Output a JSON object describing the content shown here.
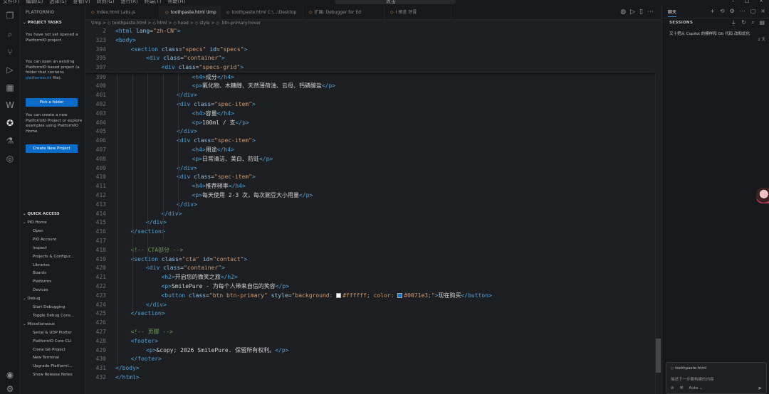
{
  "titlebar": {
    "menu": [
      "文件(F)",
      "编辑(E)",
      "选择(S)",
      "查看(V)",
      "转到(G)",
      "运行(R)",
      "终端(T)",
      "帮助(H)"
    ],
    "search": "点击"
  },
  "sidebar": {
    "title": "PLATFORMIO",
    "project_tasks": "PROJECT TASKS",
    "msg_no_project": "You have not yet opened a PlatformIO project.",
    "msg_open_prefix": "You can open an existing PlatformIO based project (a folder that contains ",
    "msg_open_file": "platformio.ini",
    "msg_open_suffix": " file).",
    "pick_folder": "Pick a folder",
    "msg_create": "You can create a new PlatformIO Project or explore examples using PlatformIO Home.",
    "create_project": "Create New Project",
    "quick_access": "QUICK ACCESS",
    "groups": {
      "pio_home": "PIO Home",
      "debug": "Debug",
      "misc": "Miscellaneous"
    },
    "pio_home_items": [
      "Open",
      "PIO Account",
      "Inspect",
      "Projects & Configur...",
      "Libraries",
      "Boards",
      "Platforms",
      "Devices"
    ],
    "debug_items": [
      "Start Debugging",
      "Toggle Debug Cons..."
    ],
    "misc_items": [
      "Serial & UDP Plotter",
      "PlatformIO Core CLI",
      "Clone Git Project",
      "New Terminal",
      "Upgrade PlatformI...",
      "Show Release Notes"
    ]
  },
  "tabs": [
    {
      "label": "index.html Labs.js",
      "active": false
    },
    {
      "label": "toothpaste.html \\tmp",
      "active": true
    },
    {
      "label": "toothpaste.html C:\\...\\Desktop",
      "active": false
    },
    {
      "label": "扩展: Debugger for Ed",
      "active": false
    },
    {
      "label": "Ⅰ 预览 牙膏",
      "active": false
    }
  ],
  "breadcrumbs": "\\tmp > ◇ toothpaste.html > ◇ html > ◇ head > ◇ style > ◇ .btn-primary:hover",
  "sticky_lines": [
    {
      "n": "2",
      "indent": 0,
      "html": "<span class='tg'>&lt;html</span> <span class='at'>lang</span>=<span class='st'>\"zh-CN\"</span><span class='tg'>&gt;</span>"
    },
    {
      "n": "323",
      "indent": 0,
      "html": "<span class='tg'>&lt;body&gt;</span>"
    },
    {
      "n": "394",
      "indent": 1,
      "html": "<span class='tg'>&lt;section</span> <span class='at'>class</span>=<span class='st'>\"specs\"</span> <span class='at'>id</span>=<span class='st'>\"specs\"</span><span class='tg'>&gt;</span>"
    },
    {
      "n": "395",
      "indent": 2,
      "html": "<span class='tg'>&lt;div</span> <span class='at'>class</span>=<span class='st'>\"container\"</span><span class='tg'>&gt;</span>"
    },
    {
      "n": "397",
      "indent": 3,
      "html": "<span class='tg'>&lt;div</span> <span class='at'>class</span>=<span class='st'>\"specs-grid\"</span><span class='tg'>&gt;</span>"
    }
  ],
  "lines": [
    {
      "n": "399",
      "indent": 5,
      "html": "<span class='tg'>&lt;h4&gt;</span><span class='tx'>成分</span><span class='tg'>&lt;/h4&gt;</span>"
    },
    {
      "n": "400",
      "indent": 5,
      "html": "<span class='tg'>&lt;p&gt;</span><span class='tx'>氟化物、木糖醇、天然薄荷油、云母、钙磷酸盐</span><span class='tg'>&lt;/p&gt;</span>"
    },
    {
      "n": "401",
      "indent": 4,
      "html": "<span class='tg'>&lt;/div&gt;</span>"
    },
    {
      "n": "402",
      "indent": 4,
      "html": "<span class='tg'>&lt;div</span> <span class='at'>class</span>=<span class='st'>\"spec-item\"</span><span class='tg'>&gt;</span>"
    },
    {
      "n": "403",
      "indent": 5,
      "html": "<span class='tg'>&lt;h4&gt;</span><span class='tx'>容量</span><span class='tg'>&lt;/h4&gt;</span>"
    },
    {
      "n": "404",
      "indent": 5,
      "html": "<span class='tg'>&lt;p&gt;</span><span class='tx'>100ml / 支</span><span class='tg'>&lt;/p&gt;</span>"
    },
    {
      "n": "405",
      "indent": 4,
      "html": "<span class='tg'>&lt;/div&gt;</span>"
    },
    {
      "n": "406",
      "indent": 4,
      "html": "<span class='tg'>&lt;div</span> <span class='at'>class</span>=<span class='st'>\"spec-item\"</span><span class='tg'>&gt;</span>"
    },
    {
      "n": "407",
      "indent": 5,
      "html": "<span class='tg'>&lt;h4&gt;</span><span class='tx'>用途</span><span class='tg'>&lt;/h4&gt;</span>"
    },
    {
      "n": "408",
      "indent": 5,
      "html": "<span class='tg'>&lt;p&gt;</span><span class='tx'>日常清洁、美白、防蛀</span><span class='tg'>&lt;/p&gt;</span>"
    },
    {
      "n": "409",
      "indent": 4,
      "html": "<span class='tg'>&lt;/div&gt;</span>"
    },
    {
      "n": "410",
      "indent": 4,
      "html": "<span class='tg'>&lt;div</span> <span class='at'>class</span>=<span class='st'>\"spec-item\"</span><span class='tg'>&gt;</span>"
    },
    {
      "n": "411",
      "indent": 5,
      "html": "<span class='tg'>&lt;h4&gt;</span><span class='tx'>推荐频率</span><span class='tg'>&lt;/h4&gt;</span>"
    },
    {
      "n": "412",
      "indent": 5,
      "html": "<span class='tg'>&lt;p&gt;</span><span class='tx'>每天使用 2-3 次，每次豌豆大小用量</span><span class='tg'>&lt;/p&gt;</span>"
    },
    {
      "n": "413",
      "indent": 4,
      "html": "<span class='tg'>&lt;/div&gt;</span>"
    },
    {
      "n": "414",
      "indent": 3,
      "html": "<span class='tg'>&lt;/div&gt;</span>"
    },
    {
      "n": "415",
      "indent": 2,
      "html": "<span class='tg'>&lt;/div&gt;</span>"
    },
    {
      "n": "416",
      "indent": 1,
      "html": "<span class='tg'>&lt;/section&gt;</span>"
    },
    {
      "n": "417",
      "indent": 0,
      "html": ""
    },
    {
      "n": "418",
      "indent": 1,
      "html": "<span class='cm'>&lt;!-- CTA部分 --&gt;</span>"
    },
    {
      "n": "419",
      "indent": 1,
      "html": "<span class='tg'>&lt;section</span> <span class='at'>class</span>=<span class='st'>\"cta\"</span> <span class='at'>id</span>=<span class='st'>\"contact\"</span><span class='tg'>&gt;</span>"
    },
    {
      "n": "420",
      "indent": 2,
      "html": "<span class='tg'>&lt;div</span> <span class='at'>class</span>=<span class='st'>\"container\"</span><span class='tg'>&gt;</span>"
    },
    {
      "n": "421",
      "indent": 3,
      "html": "<span class='tg'>&lt;h2&gt;</span><span class='tx'>开启您的微笑之旅</span><span class='tg'>&lt;/h2&gt;</span>"
    },
    {
      "n": "422",
      "indent": 3,
      "html": "<span class='tg'>&lt;p&gt;</span><span class='tx'>SmilePure - 为每个人带来自信的笑容</span><span class='tg'>&lt;/p&gt;</span>"
    },
    {
      "n": "423",
      "indent": 3,
      "html": "<span class='tg'>&lt;button</span> <span class='at'>class</span>=<span class='st'>\"btn btn-primary\"</span> <span class='at'>style</span>=<span class='st'>\"background: <span class='sw' style='background:#ffffff'></span>#ffffff; color: <span class='sw' style='background:#0071e3'></span>#0071e3;\"</span><span class='tg'>&gt;</span><span class='tx'>现在购买</span><span class='tg'>&lt;/button&gt;</span>"
    },
    {
      "n": "424",
      "indent": 2,
      "html": "<span class='tg'>&lt;/div&gt;</span>"
    },
    {
      "n": "425",
      "indent": 1,
      "html": "<span class='tg'>&lt;/section&gt;</span>"
    },
    {
      "n": "426",
      "indent": 0,
      "html": ""
    },
    {
      "n": "427",
      "indent": 1,
      "html": "<span class='cm'>&lt;!-- 页脚 --&gt;</span>"
    },
    {
      "n": "428",
      "indent": 1,
      "html": "<span class='tg'>&lt;footer&gt;</span>"
    },
    {
      "n": "429",
      "indent": 2,
      "html": "<span class='tg'>&lt;p&gt;</span><span class='tx'>&amp;copy; 2026 SmilePure. 保留所有权利。</span><span class='tg'>&lt;/p&gt;</span>"
    },
    {
      "n": "430",
      "indent": 1,
      "html": "<span class='tg'>&lt;/footer&gt;</span>"
    },
    {
      "n": "431",
      "indent": 0,
      "html": "<span class='tg'>&lt;/body&gt;</span>"
    },
    {
      "n": "432",
      "indent": 0,
      "html": "<span class='tg'>&lt;/html&gt;</span>"
    }
  ],
  "chat": {
    "tab": "聊天",
    "sessions_header": "SESSIONS",
    "session_title": "又十把从 Copilot 的模样和 Git 代码 改和优化",
    "session_time": "2 天",
    "attached_file": "toothpaste.html",
    "input_placeholder": "描述下一步要构建的内容",
    "mode_label": "Auto"
  },
  "colors": {
    "accent": "#0a6cc8",
    "editor_bg": "#1e1f22",
    "tag": "#4fa3d6",
    "attr": "#89c2e8",
    "string": "#cf9b71",
    "comment": "#6b9a56"
  }
}
